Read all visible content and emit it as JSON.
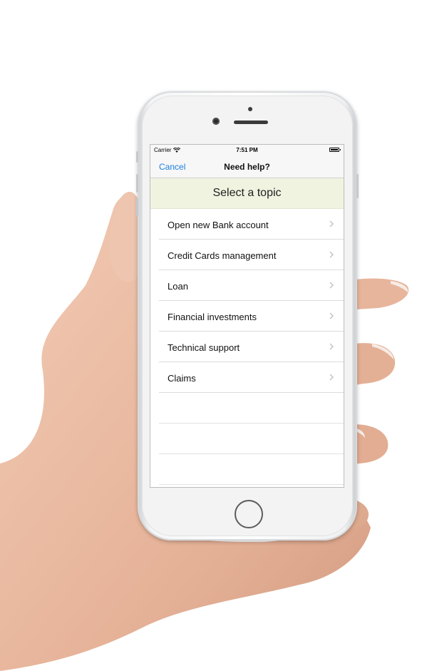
{
  "status_bar": {
    "carrier": "Carrier",
    "time": "7:51 PM"
  },
  "nav": {
    "cancel_label": "Cancel",
    "title": "Need help?"
  },
  "header": {
    "title": "Select a topic"
  },
  "topics": [
    {
      "label": "Open new Bank account"
    },
    {
      "label": "Credit Cards management"
    },
    {
      "label": "Loan"
    },
    {
      "label": "Financial investments"
    },
    {
      "label": "Technical support"
    },
    {
      "label": "Claims"
    }
  ],
  "colors": {
    "accent": "#1a7fe0",
    "header_bg": "#f0f3e0",
    "separator": "#dcdcdc"
  },
  "icons": {
    "wifi": "wifi-icon",
    "battery": "battery-icon",
    "row_chevron": "chevron-right-icon"
  }
}
